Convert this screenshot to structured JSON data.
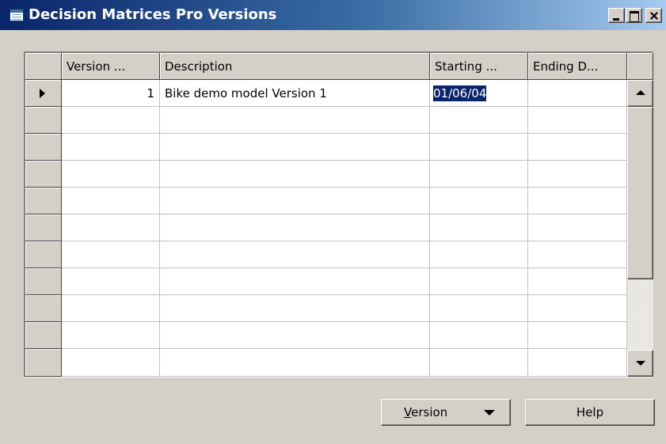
{
  "window": {
    "title": "Decision Matrices Pro Versions",
    "minimize_icon": "minimize-icon",
    "maximize_icon": "maximize-icon",
    "close_icon": "close-icon"
  },
  "grid": {
    "columns": [
      "Version ...",
      "Description",
      "Starting ...",
      "Ending D..."
    ],
    "rows": [
      {
        "version": "1",
        "description": "Bike demo model Version  1",
        "starting": "01/06/04",
        "ending": ""
      }
    ],
    "selected_cell_text": "01/06/04"
  },
  "buttons": {
    "version_prefix": "V",
    "version_rest": "ersion",
    "help": "Help"
  }
}
